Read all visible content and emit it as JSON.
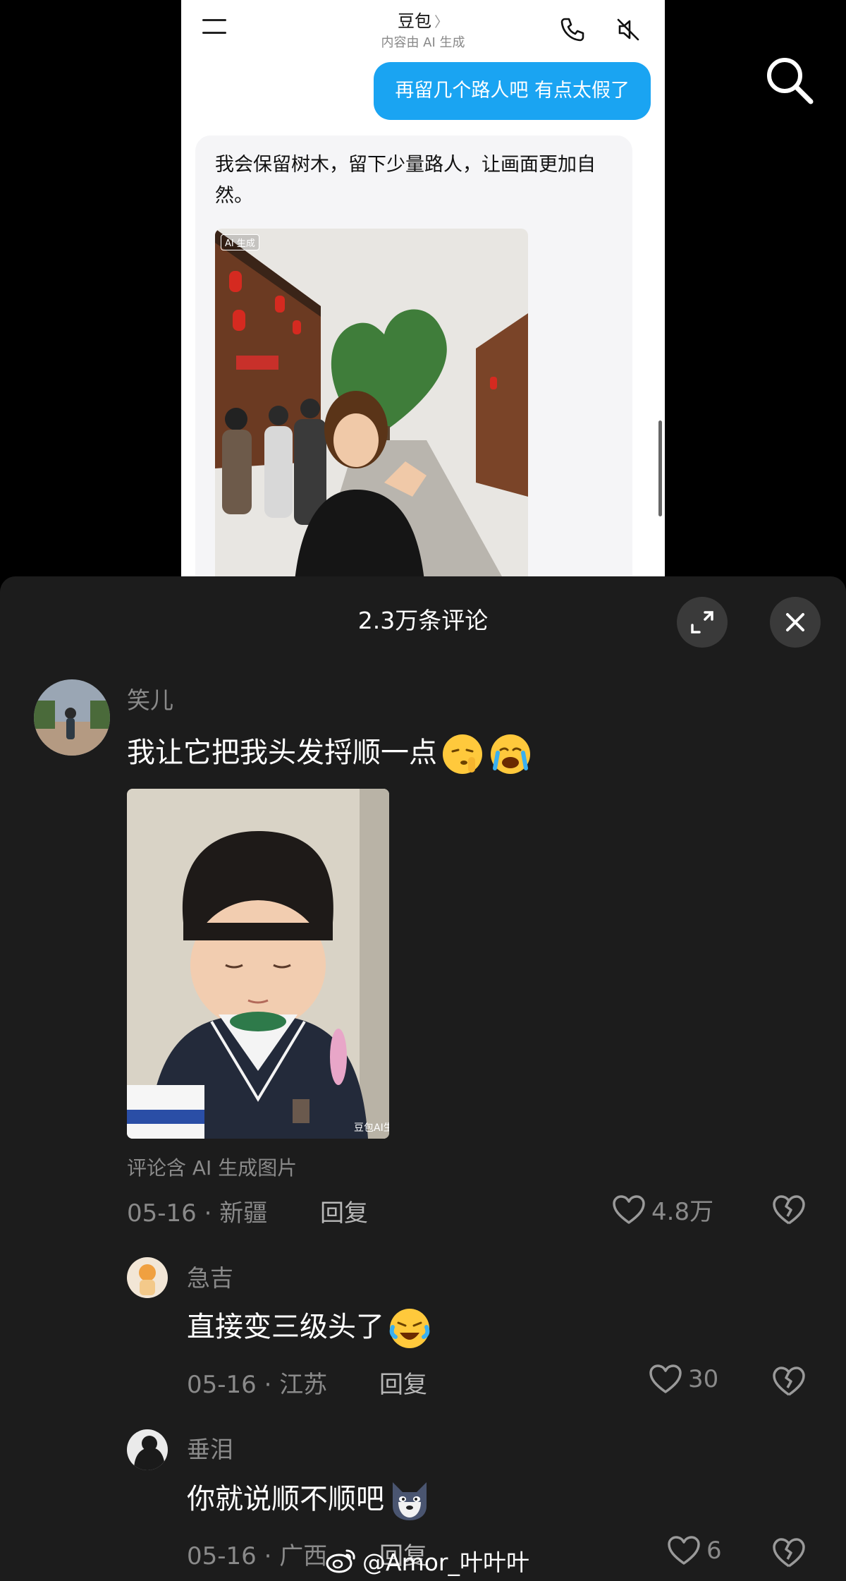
{
  "phone": {
    "title": "豆包",
    "title_chevron": "〉",
    "subtitle": "内容由 AI 生成",
    "user_message": "再留几个路人吧 有点太假了",
    "ai_reply": "我会保留树木，留下少量路人，让画面更加自然。",
    "ai_image_badge": "AI 生成"
  },
  "sheet": {
    "title": "2.3万条评论"
  },
  "comments": [
    {
      "user": "笑儿",
      "text": "我让它把我头发捋顺一点",
      "emojis": [
        "shushing-face-emoji",
        "crying-face-emoji"
      ],
      "image_badge": "豆包AI生成",
      "ai_note": "评论含 AI 生成图片",
      "date": "05-16",
      "location": "新疆",
      "reply_label": "回复",
      "likes": "4.8万"
    },
    {
      "user": "急吉",
      "text": "直接变三级头了",
      "emojis": [
        "laughing-crying-face-emoji"
      ],
      "date": "05-16",
      "location": "江苏",
      "reply_label": "回复",
      "likes": "30"
    },
    {
      "user": "垂泪",
      "text": "你就说顺不顺吧",
      "emojis": [
        "wolf-face-emoji"
      ],
      "date": "05-16",
      "location": "广西",
      "reply_label": "回复",
      "likes": "6"
    }
  ],
  "separator": "·",
  "watermark": "@Amor_叶叶叶",
  "colors": {
    "user_bubble": "#1aa4f2",
    "sheet_bg": "#1c1c1c",
    "muted_text": "#8a8a8a"
  }
}
